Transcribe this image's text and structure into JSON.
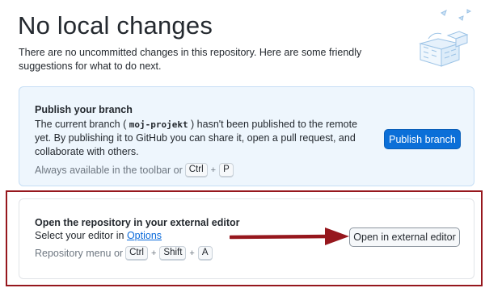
{
  "page": {
    "title": "No local changes",
    "subtitle": "There are no uncommitted changes in this repository. Here are some friendly suggestions for what to do next."
  },
  "publish": {
    "title": "Publish your branch",
    "body_pre": "The current branch ( ",
    "branch": "moj-projekt",
    "body_post": " ) hasn't been published to the remote yet. By publishing it to GitHub you can share it, open a pull request, and collaborate with others.",
    "hint": "Always available in the toolbar or",
    "shortcut": [
      "Ctrl",
      "P"
    ],
    "button_label": "Publish branch"
  },
  "editor": {
    "title": "Open the repository in your external editor",
    "body_pre": "Select your editor in ",
    "body_link": "Options",
    "hint": "Repository menu or",
    "shortcut": [
      "Ctrl",
      "Shift",
      "A"
    ],
    "button_label": "Open in external editor"
  },
  "colors": {
    "accent": "#0b6fd8",
    "highlight": "#96171d"
  }
}
